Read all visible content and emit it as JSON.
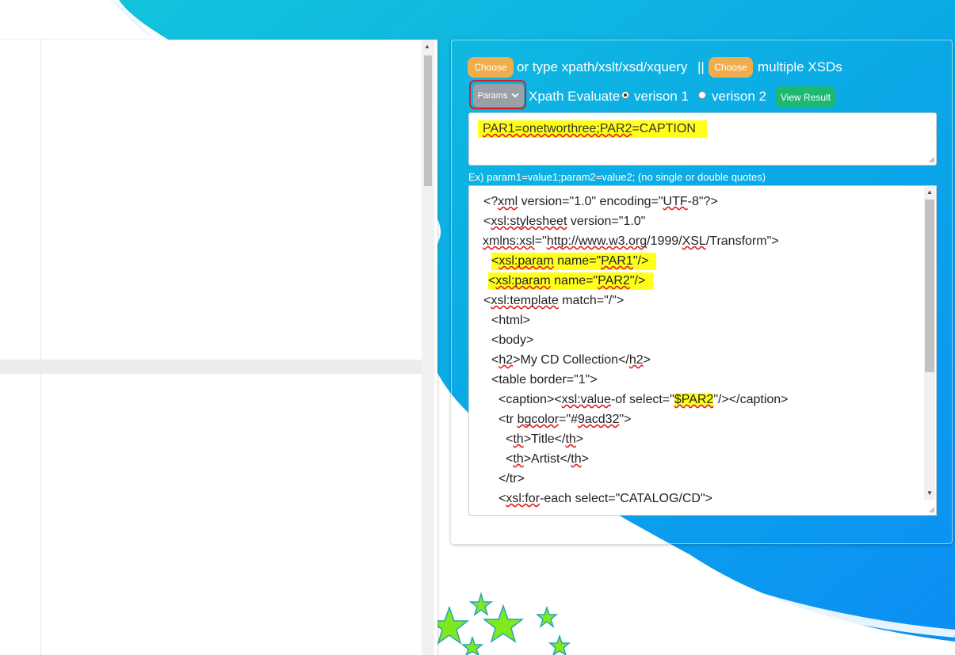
{
  "colors": {
    "accent_blue": "#1a9ee6",
    "orange_button": "#f0ad4e",
    "green_button": "#1db871",
    "highlight": "#ffff1a",
    "annotation_red": "#d0202a"
  },
  "toolbar": {
    "choose_label_1": "Choose",
    "choose_text_1": "or type xpath/xslt/xsd/xquery",
    "separator": "||",
    "choose_label_2": "Choose",
    "choose_text_2": "multiple XSDs",
    "params_label": "Params",
    "params_icon": "chevron-down-icon",
    "xpath_label": "Xpath Evaluate",
    "version1_label": "verison 1",
    "version2_label": "verison 2",
    "version_selected": "verison 1",
    "view_result_label": "View Result"
  },
  "params": {
    "value": "PAR1=onetworthree;PAR2=CAPTION",
    "hint": "Ex) param1=value1;param2=value2; (no single or double quotes)"
  },
  "editor": {
    "lines": [
      "<?xml version=\"1.0\" encoding=\"UTF-8\"?>",
      "<xsl:stylesheet version=\"1.0\"",
      "xmlns:xsl=\"http://www.w3.org/1999/XSL/Transform\">",
      "<xsl:param name=\"PAR1\"/>",
      "<xsl:param name=\"PAR2\"/>",
      "<xsl:template match=\"/\">",
      "<html>",
      "<body>",
      "<h2>My CD Collection</h2>",
      "<table border=\"1\">",
      "<caption><xsl:value-of select=\"$PAR2\"/></caption>",
      "<tr bgcolor=\"#9acd32\">",
      "<th>Title</th>",
      "<th>Artist</th>",
      "</tr>",
      "<xsl:for-each select=\"CATALOG/CD\">"
    ]
  }
}
